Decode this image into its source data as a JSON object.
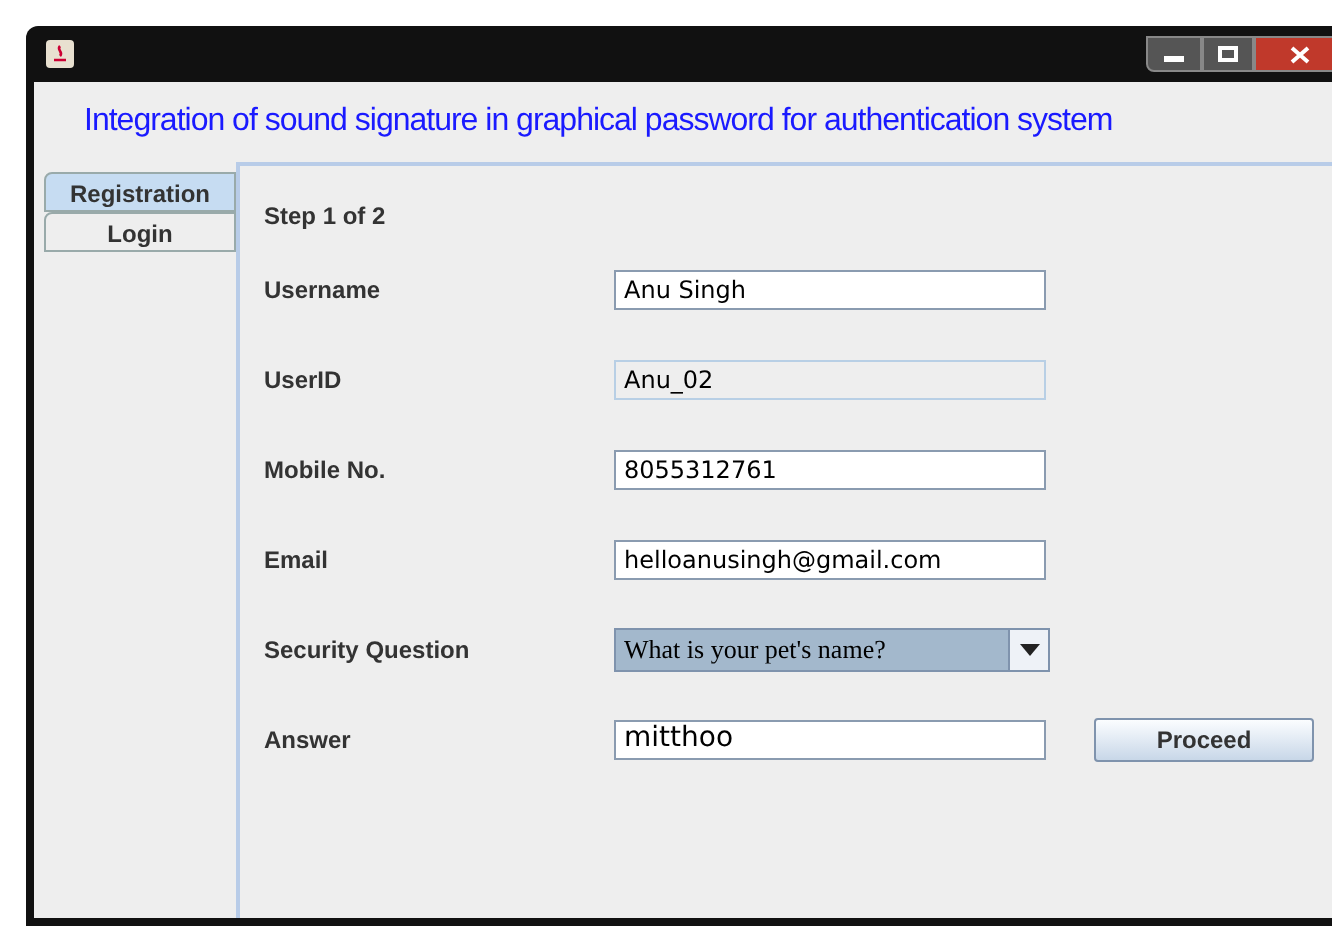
{
  "heading": "Integration of sound signature in graphical password for authentication system",
  "tabs": [
    {
      "label": "Registration",
      "selected": true
    },
    {
      "label": "Login",
      "selected": false
    }
  ],
  "step": "Step 1 of 2",
  "fields": [
    {
      "label": "Username",
      "kind": "text",
      "value": "Anu Singh"
    },
    {
      "label": "UserID",
      "kind": "readonly",
      "value": "Anu_02"
    },
    {
      "label": "Mobile No.",
      "kind": "text",
      "value": "8055312761"
    },
    {
      "label": "Email",
      "kind": "text",
      "value": "helloanusingh@gmail.com"
    },
    {
      "label": "Security Question",
      "kind": "select",
      "value": "What is your pet's name?"
    },
    {
      "label": "Answer",
      "kind": "answer",
      "value": "mitthoo"
    }
  ],
  "button": "Proceed"
}
